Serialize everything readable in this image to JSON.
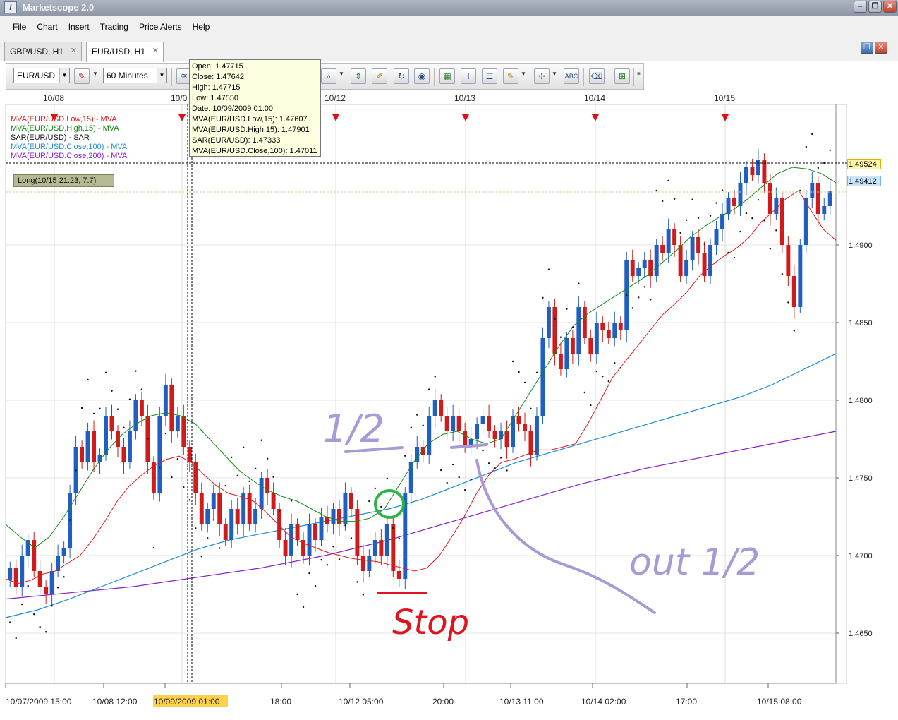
{
  "window": {
    "title": "Marketscope 2.0",
    "buttons": {
      "minimize": "–",
      "restore": "❒",
      "close": "✕"
    }
  },
  "menu": [
    "File",
    "Chart",
    "Insert",
    "Trading",
    "Price Alerts",
    "Help"
  ],
  "tabs": [
    {
      "label": "GBP/USD, H1",
      "active": false
    },
    {
      "label": "EUR/USD, H1",
      "active": true
    }
  ],
  "toolbar": {
    "instrument": "EUR/USD",
    "timeframe": "60 Minutes"
  },
  "tooltip": {
    "lines": [
      "Open: 1.47715",
      "Close: 1.47642",
      "High: 1.47715",
      "Low: 1.47550",
      "Date: 10/09/2009 01:00",
      "MVA(EUR/USD.Low,15): 1.47607",
      "MVA(EUR/USD.High,15): 1.47901",
      "SAR(EUR/USD): 1.47333",
      "MVA(EUR/USD.Close,100): 1.47011"
    ]
  },
  "trade_label": "Long(10/15 21:23, 7.7)",
  "colors": {
    "bull": "#1f5fc2",
    "bear": "#d11a1a",
    "ma_low": "#e11a1a",
    "ma_high": "#178a17",
    "ma_100": "#1e8bd6",
    "ma_200": "#8a1fc9",
    "annot_purple": "#a99ad6",
    "annot_green": "#2bb54a",
    "annot_red": "#e0141e"
  },
  "annotations": {
    "half_top": "1/2",
    "out_half": "out 1/2",
    "stop": "Stop"
  },
  "chart_data": {
    "type": "candlestick",
    "instrument": "EUR/USD",
    "timeframe": "H1",
    "price_labels": [
      "1.4900",
      "1.4850",
      "1.4800",
      "1.4750",
      "1.4700",
      "1.4650"
    ],
    "ylim": [
      1.465,
      1.495
    ],
    "current_price": "1.49524",
    "bid_price": "1.49412",
    "top_date_labels": [
      "10/08",
      "10/0",
      "10/12",
      "10/13",
      "10/14",
      "10/15"
    ],
    "bottom_time_labels": [
      "10/07/2009 15:00",
      "10/08 12:00",
      "10/09/2009 01:00",
      "18:00",
      "10/12 05:00",
      "20:00",
      "10/13 11:00",
      "10/14 02:00",
      "17:00",
      "10/15 08:00"
    ],
    "highlighted_time": "10/09/2009 01:00",
    "legend": [
      {
        "name": "MVA(EUR/USD.Low,15) - MVA",
        "color": "#e11a1a"
      },
      {
        "name": "MVA(EUR/USD.High,15) - MVA",
        "color": "#178a17"
      },
      {
        "name": "SAR(EUR/USD) - SAR",
        "color": "#111111"
      },
      {
        "name": "MVA(EUR/USD.Close,100) - MVA",
        "color": "#1e8bd6"
      },
      {
        "name": "MVA(EUR/USD.Close,200) - MVA",
        "color": "#8a1fc9"
      }
    ],
    "closes": [
      1.4692,
      1.468,
      1.47,
      1.471,
      1.469,
      1.468,
      1.4675,
      1.469,
      1.47,
      1.4705,
      1.474,
      1.477,
      1.476,
      1.478,
      1.476,
      1.4765,
      1.479,
      1.478,
      1.477,
      1.476,
      1.478,
      1.48,
      1.479,
      1.476,
      1.474,
      1.479,
      1.481,
      1.478,
      1.479,
      1.477,
      1.476,
      1.474,
      1.472,
      1.473,
      1.474,
      1.472,
      1.471,
      1.473,
      1.472,
      1.474,
      1.472,
      1.473,
      1.475,
      1.474,
      1.473,
      1.471,
      1.47,
      1.472,
      1.471,
      1.47,
      1.472,
      1.471,
      1.4725,
      1.472,
      1.473,
      1.472,
      1.474,
      1.473,
      1.47,
      1.469,
      1.47,
      1.471,
      1.47,
      1.472,
      1.469,
      1.4685,
      1.474,
      1.476,
      1.477,
      1.4765,
      1.479,
      1.48,
      1.479,
      1.478,
      1.479,
      1.478,
      1.477,
      1.4775,
      1.4785,
      1.479,
      1.478,
      1.4775,
      1.478,
      1.477,
      1.479,
      1.4785,
      1.478,
      1.4765,
      1.479,
      1.484,
      1.486,
      1.483,
      1.482,
      1.484,
      1.483,
      1.486,
      1.484,
      1.483,
      1.485,
      1.4845,
      1.484,
      1.485,
      1.4845,
      1.489,
      1.488,
      1.4885,
      1.489,
      1.488,
      1.49,
      1.4895,
      1.491,
      1.49,
      1.488,
      1.489,
      1.4905,
      1.4895,
      1.488,
      1.49,
      1.491,
      1.492,
      1.493,
      1.4925,
      1.494,
      1.495,
      1.4945,
      1.4955,
      1.494,
      1.492,
      1.493,
      1.49,
      1.488,
      1.486,
      1.49,
      1.493,
      1.494,
      1.492,
      1.4925,
      1.4935
    ],
    "ma_low_15": [
      1.4685,
      1.4682,
      1.4684,
      1.4688,
      1.469,
      1.4695,
      1.47,
      1.471,
      1.4722,
      1.4735,
      1.4745,
      1.4752,
      1.4758,
      1.4762,
      1.4764,
      1.476,
      1.4752,
      1.4745,
      1.474,
      1.4738,
      1.4735,
      1.4728,
      1.472,
      1.4712,
      1.4708,
      1.4705,
      1.4702,
      1.47,
      1.4698,
      1.4697,
      1.4696,
      1.4694,
      1.4692,
      1.469,
      1.4692,
      1.47,
      1.4712,
      1.4725,
      1.474,
      1.4752,
      1.476,
      1.4762,
      1.4765,
      1.4768,
      1.4768,
      1.477,
      1.4772,
      1.4785,
      1.48,
      1.4815,
      1.4825,
      1.4835,
      1.4845,
      1.4855,
      1.4862,
      1.487,
      1.488,
      1.4887,
      1.4893,
      1.4898,
      1.4905,
      1.4915,
      1.4922,
      1.493,
      1.4935,
      1.4922,
      1.491,
      1.4903
    ],
    "ma_high_15": [
      1.472,
      1.4712,
      1.4705,
      1.4712,
      1.4725,
      1.474,
      1.4755,
      1.4768,
      1.4778,
      1.4785,
      1.479,
      1.4792,
      1.479,
      1.4785,
      1.4775,
      1.4765,
      1.4755,
      1.4748,
      1.4742,
      1.4738,
      1.4735,
      1.473,
      1.4725,
      1.4722,
      1.4722,
      1.4724,
      1.473,
      1.4745,
      1.476,
      1.4772,
      1.4778,
      1.478,
      1.4775,
      1.4772,
      1.4775,
      1.479,
      1.4805,
      1.482,
      1.4835,
      1.4848,
      1.4856,
      1.4862,
      1.4868,
      1.4874,
      1.488,
      1.4888,
      1.4896,
      1.4905,
      1.4912,
      1.4918,
      1.4923,
      1.493,
      1.4938,
      1.4946,
      1.495,
      1.4949,
      1.4946,
      1.494
    ],
    "ma_close_100": [
      1.466,
      1.4665,
      1.4672,
      1.468,
      1.4688,
      1.4696,
      1.4704,
      1.471,
      1.4714,
      1.4718,
      1.4722,
      1.4726,
      1.473,
      1.4736,
      1.4744,
      1.4752,
      1.476,
      1.4766,
      1.4772,
      1.4778,
      1.4784,
      1.479,
      1.4796,
      1.4802,
      1.481,
      1.482,
      1.483
    ],
    "ma_close_200": [
      1.4672,
      1.4676,
      1.468,
      1.4686,
      1.4692,
      1.47,
      1.471,
      1.4722,
      1.4734,
      1.4746,
      1.4756,
      1.4764,
      1.4772,
      1.478
    ]
  }
}
